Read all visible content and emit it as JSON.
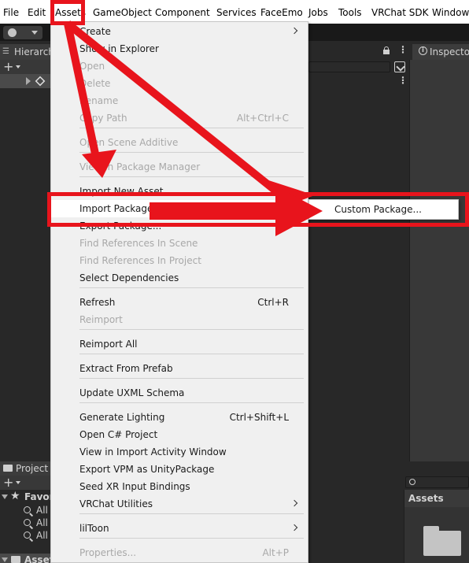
{
  "menubar": {
    "items": [
      "File",
      "Edit",
      "Assets",
      "GameObject",
      "Component",
      "Services",
      "FaceEmo",
      "Jobs",
      "Tools",
      "VRChat SDK",
      "Window"
    ]
  },
  "hierarchy": {
    "tab_label": "Hierarchy"
  },
  "inspector": {
    "tab_label": "Inspector"
  },
  "project": {
    "tab_label": "Project",
    "favorites_label": "Favorites",
    "all_items": [
      "All",
      "All",
      "All"
    ],
    "assets_label": "Assets",
    "assets_pane_header": "Assets"
  },
  "assets_menu": {
    "items": [
      {
        "label": "Create",
        "shortcut": "",
        "submenu": true,
        "enabled": true
      },
      {
        "label": "Show in Explorer",
        "shortcut": "",
        "submenu": false,
        "enabled": true
      },
      {
        "label": "Open",
        "shortcut": "",
        "submenu": false,
        "enabled": false
      },
      {
        "label": "Delete",
        "shortcut": "",
        "submenu": false,
        "enabled": false
      },
      {
        "label": "Rename",
        "shortcut": "",
        "submenu": false,
        "enabled": false
      },
      {
        "label": "Copy Path",
        "shortcut": "Alt+Ctrl+C",
        "submenu": false,
        "enabled": false
      },
      {
        "label": "Open Scene Additive",
        "shortcut": "",
        "submenu": false,
        "enabled": false
      },
      {
        "label": "View in Package Manager",
        "shortcut": "",
        "submenu": false,
        "enabled": false
      },
      {
        "label": "Import New Asset...",
        "shortcut": "",
        "submenu": false,
        "enabled": true
      },
      {
        "label": "Import Package",
        "shortcut": "",
        "submenu": true,
        "enabled": true
      },
      {
        "label": "Export Package...",
        "shortcut": "",
        "submenu": false,
        "enabled": true
      },
      {
        "label": "Find References In Scene",
        "shortcut": "",
        "submenu": false,
        "enabled": false
      },
      {
        "label": "Find References In Project",
        "shortcut": "",
        "submenu": false,
        "enabled": false
      },
      {
        "label": "Select Dependencies",
        "shortcut": "",
        "submenu": false,
        "enabled": true
      },
      {
        "label": "Refresh",
        "shortcut": "Ctrl+R",
        "submenu": false,
        "enabled": true
      },
      {
        "label": "Reimport",
        "shortcut": "",
        "submenu": false,
        "enabled": false
      },
      {
        "label": "Reimport All",
        "shortcut": "",
        "submenu": false,
        "enabled": true
      },
      {
        "label": "Extract From Prefab",
        "shortcut": "",
        "submenu": false,
        "enabled": true
      },
      {
        "label": "Update UXML Schema",
        "shortcut": "",
        "submenu": false,
        "enabled": true
      },
      {
        "label": "Generate Lighting",
        "shortcut": "Ctrl+Shift+L",
        "submenu": false,
        "enabled": true
      },
      {
        "label": "Open C# Project",
        "shortcut": "",
        "submenu": false,
        "enabled": true
      },
      {
        "label": "View in Import Activity Window",
        "shortcut": "",
        "submenu": false,
        "enabled": true
      },
      {
        "label": "Export VPM as UnityPackage",
        "shortcut": "",
        "submenu": false,
        "enabled": true
      },
      {
        "label": "Seed XR Input Bindings",
        "shortcut": "",
        "submenu": false,
        "enabled": true
      },
      {
        "label": "VRChat Utilities",
        "shortcut": "",
        "submenu": true,
        "enabled": true
      },
      {
        "label": "lilToon",
        "shortcut": "",
        "submenu": true,
        "enabled": true
      },
      {
        "label": "Properties...",
        "shortcut": "Alt+P",
        "submenu": false,
        "enabled": false
      }
    ]
  },
  "import_package_submenu": {
    "items": [
      "Custom Package..."
    ]
  },
  "colors": {
    "annotation_red": "#e8141c",
    "menu_bg": "#f0f0f0",
    "editor_bg": "#282828"
  },
  "icons": [
    "account-icon",
    "dropdown-icon",
    "hierarchy-icon",
    "add-icon",
    "unity-scene-icon",
    "lock-icon",
    "more-icon",
    "picker-icon",
    "info-icon",
    "folder-icon",
    "star-icon",
    "search-icon",
    "chevron-right-icon"
  ]
}
